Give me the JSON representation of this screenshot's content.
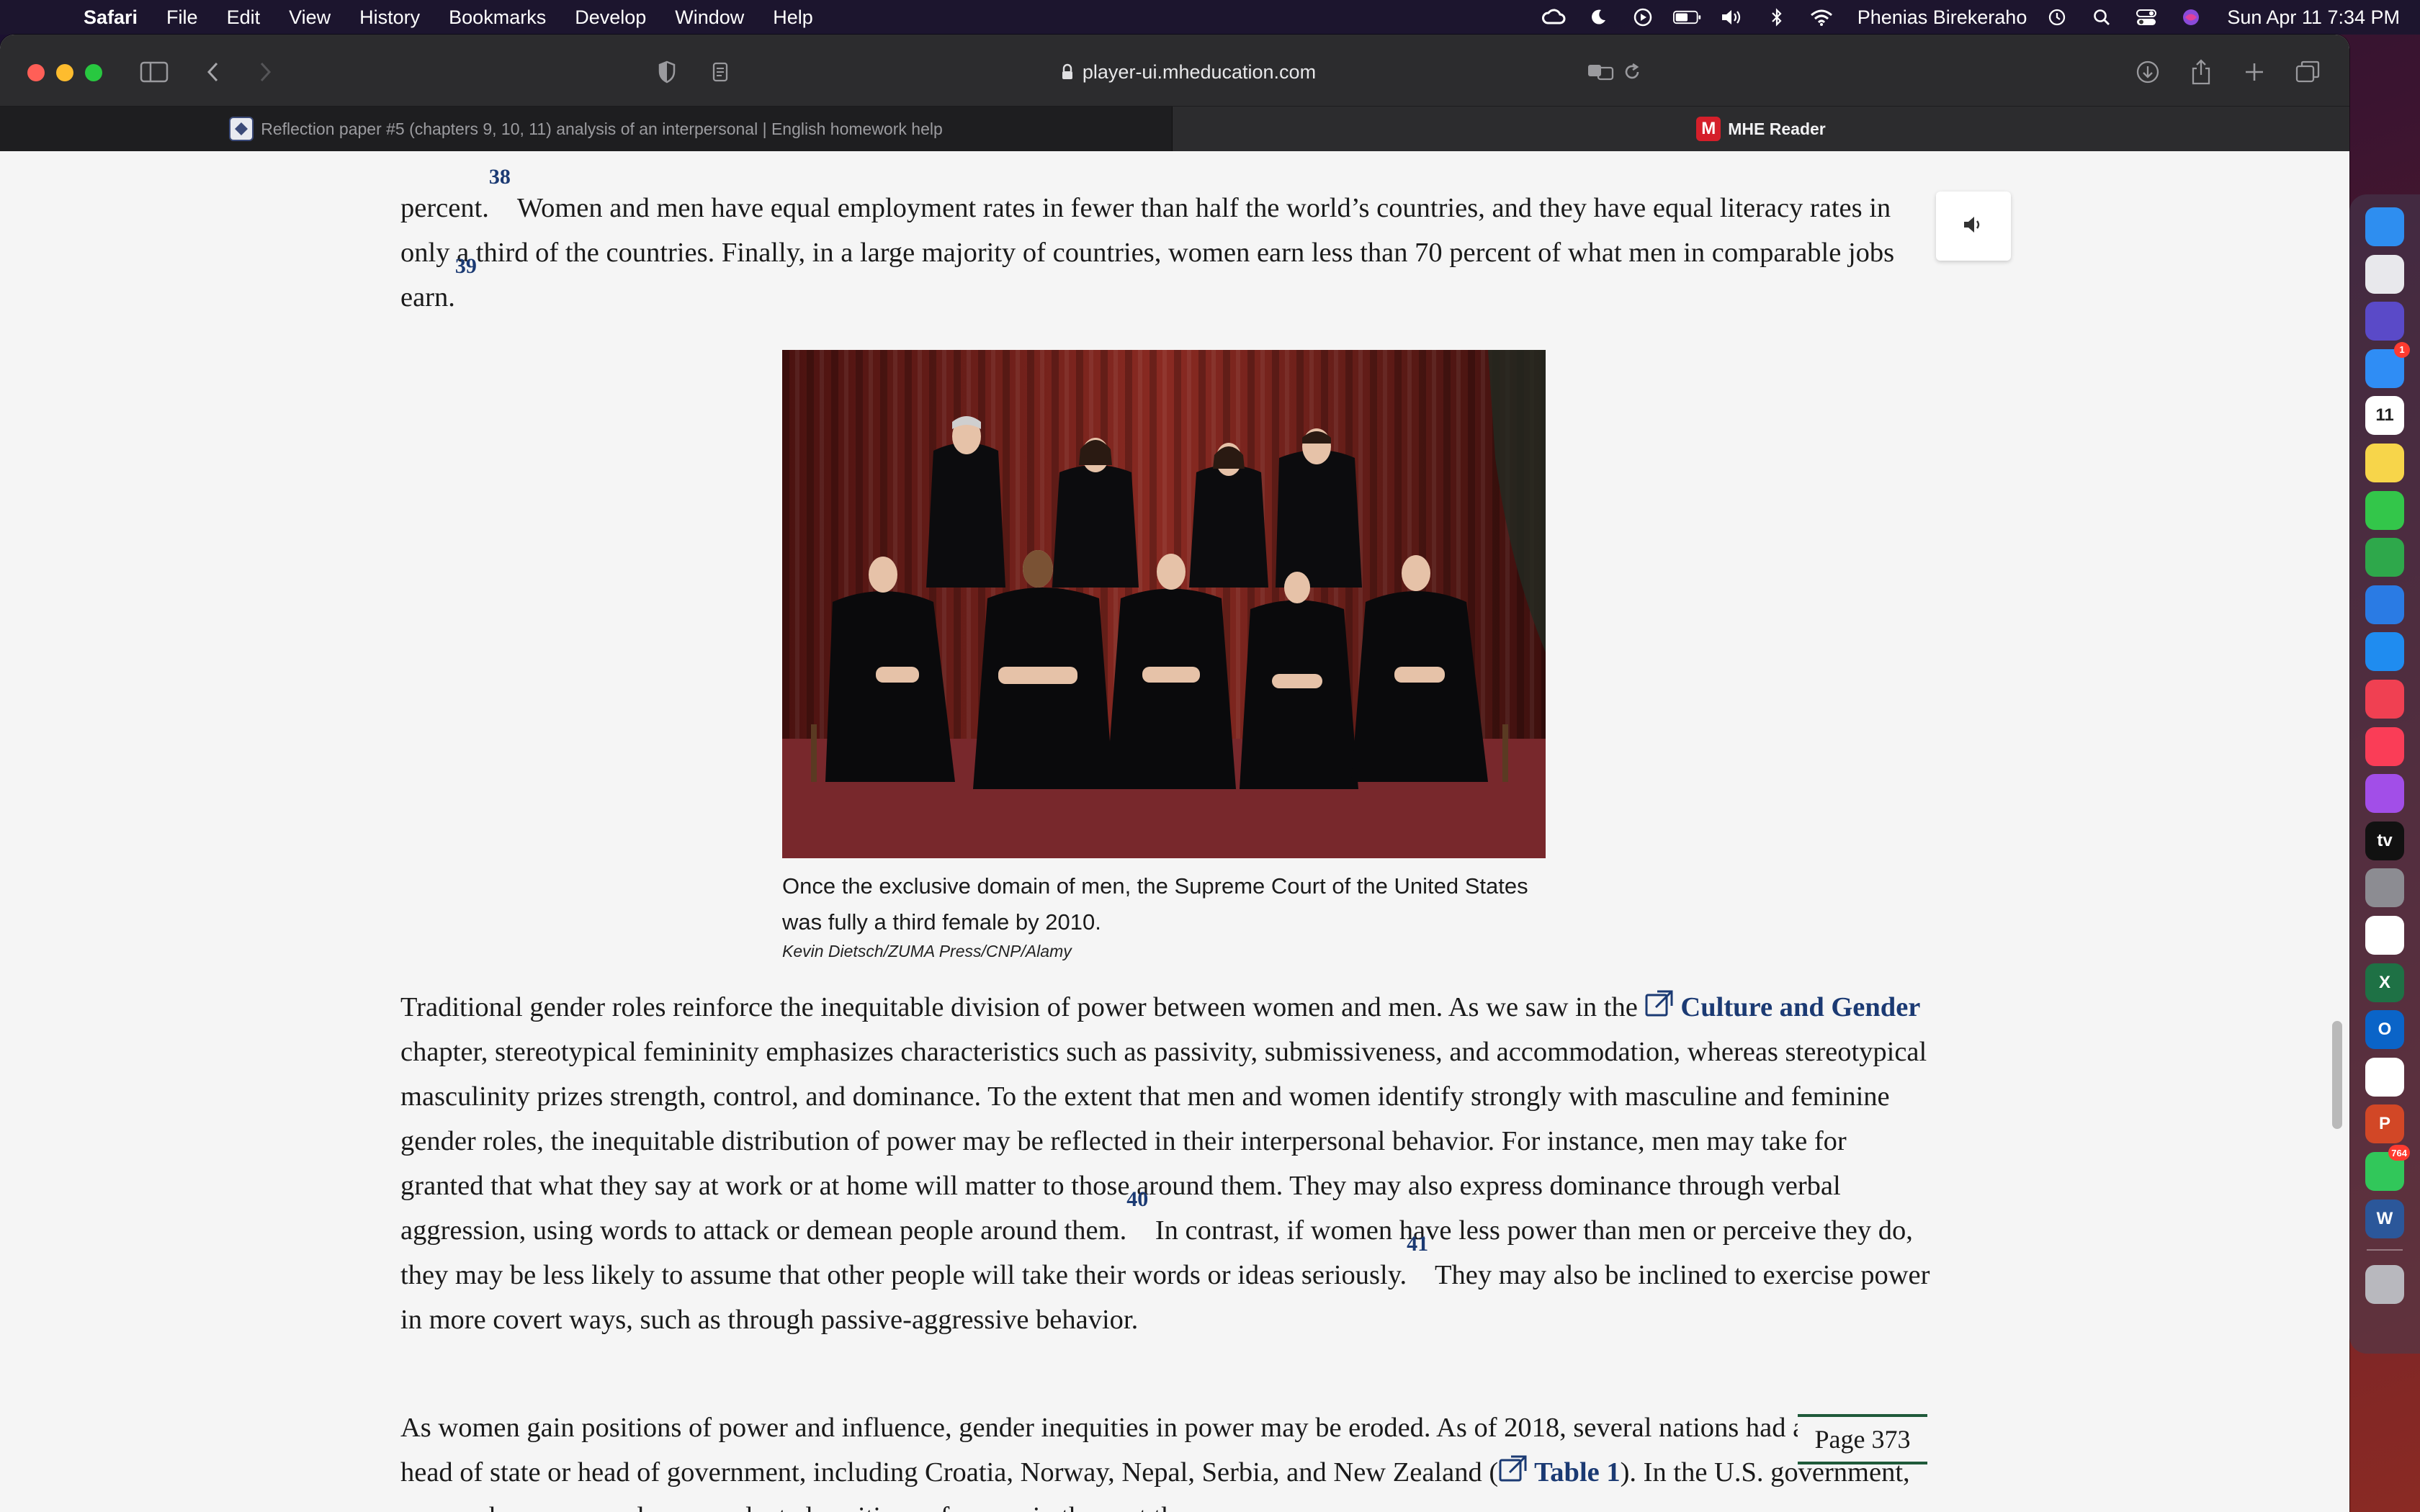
{
  "menubar": {
    "apple_glyph": "",
    "app_name": "Safari",
    "menus": [
      "File",
      "Edit",
      "View",
      "History",
      "Bookmarks",
      "Develop",
      "Window",
      "Help"
    ],
    "user_name": "Phenias Birekeraho",
    "datetime": "Sun Apr 11  7:34 PM"
  },
  "browser": {
    "url": "player-ui.mheducation.com",
    "tabs": [
      {
        "title": "Reflection paper #5 (chapters 9, 10, 11) analysis of an interpersonal | English homework help",
        "active": false
      },
      {
        "title": "MHE Reader",
        "favicon_letter": "M",
        "active": true
      }
    ]
  },
  "article": {
    "para1": {
      "lead": "percent.",
      "ref1": "38",
      "mid": " Women and men have equal employment rates in fewer than half the world’s countries, and they have equal literacy rates in only a third of the countries. Finally, in a large majority of countries, women earn less than 70 percent of what men in comparable jobs earn.",
      "ref2": "39"
    },
    "figure": {
      "caption": "Once the exclusive domain of men, the Supreme Court of the United States was fully a third female by 2010.",
      "credit": "Kevin Dietsch/ZUMA Press/CNP/Alamy"
    },
    "para2": {
      "part1": "Traditional gender roles reinforce the inequitable division of power between women and men. As we saw in the ",
      "link": "Culture and Gender",
      "part2": " chapter, stereotypical femininity emphasizes characteristics such as passivity, submissiveness, and accommodation, whereas stereotypical masculinity prizes strength, control, and dominance. To the extent that men and women identify strongly with masculine and feminine gender roles, the inequitable distribution of power may be reflected in their interpersonal behavior. For instance, men may take for granted that what they say at work or at home will matter to those around them. They may also express dominance through verbal aggression, using words to attack or demean people around them.",
      "ref1": "40",
      "part3": " In contrast, if women have less power than men or perceive they do, they may be less likely to assume that other people will take their words or ideas seriously.",
      "ref2": "41",
      "part4": " They may also be inclined to exercise power in more covert ways, such as through passive-aggressive behavior."
    },
    "para3": {
      "part1": "As women gain positions of power and influence, gender inequities in power may be eroded. As of 2018, several nations had a female head of state or head of government, including Croatia, Norway, Nepal, Serbia, and New Zealand (",
      "link": "Table 1",
      "part2": "). In the U.S. government, women have assumed unprecedented positions of power in the past three"
    },
    "page_marker": "Page 373"
  },
  "dock": {
    "items": [
      {
        "name": "finder",
        "color": "#2e8ef0"
      },
      {
        "name": "launchpad",
        "color": "#e8e8ec"
      },
      {
        "name": "siri",
        "color": "#5a4ac8"
      },
      {
        "name": "mail",
        "color": "#2f8df5",
        "badge": "1"
      },
      {
        "name": "calendar",
        "color": "#ffffff",
        "label": "11",
        "sublabel": "APR"
      },
      {
        "name": "notes",
        "color": "#f7d54a"
      },
      {
        "name": "facetime",
        "color": "#33c64a"
      },
      {
        "name": "numbers",
        "color": "#2ea84b"
      },
      {
        "name": "keynote",
        "color": "#2a7be4"
      },
      {
        "name": "safari",
        "color": "#1f8cf0"
      },
      {
        "name": "news",
        "color": "#f04052"
      },
      {
        "name": "music",
        "color": "#fa3d57"
      },
      {
        "name": "podcasts",
        "color": "#a24ee8"
      },
      {
        "name": "appletv",
        "color": "#111111",
        "label": "tv"
      },
      {
        "name": "system-preferences",
        "color": "#8c8c92"
      },
      {
        "name": "photos",
        "color": "#ffffff"
      },
      {
        "name": "excel",
        "color": "#1e7145",
        "label": "X"
      },
      {
        "name": "outlook",
        "color": "#0a64c8",
        "label": "O"
      },
      {
        "name": "chrome",
        "color": "#ffffff"
      },
      {
        "name": "powerpoint",
        "color": "#d24726",
        "label": "P"
      },
      {
        "name": "messages",
        "color": "#31c75a",
        "badge": "764"
      },
      {
        "name": "word",
        "color": "#2b579a",
        "label": "W"
      },
      {
        "name": "trash",
        "color": "#b8b8be"
      }
    ]
  }
}
